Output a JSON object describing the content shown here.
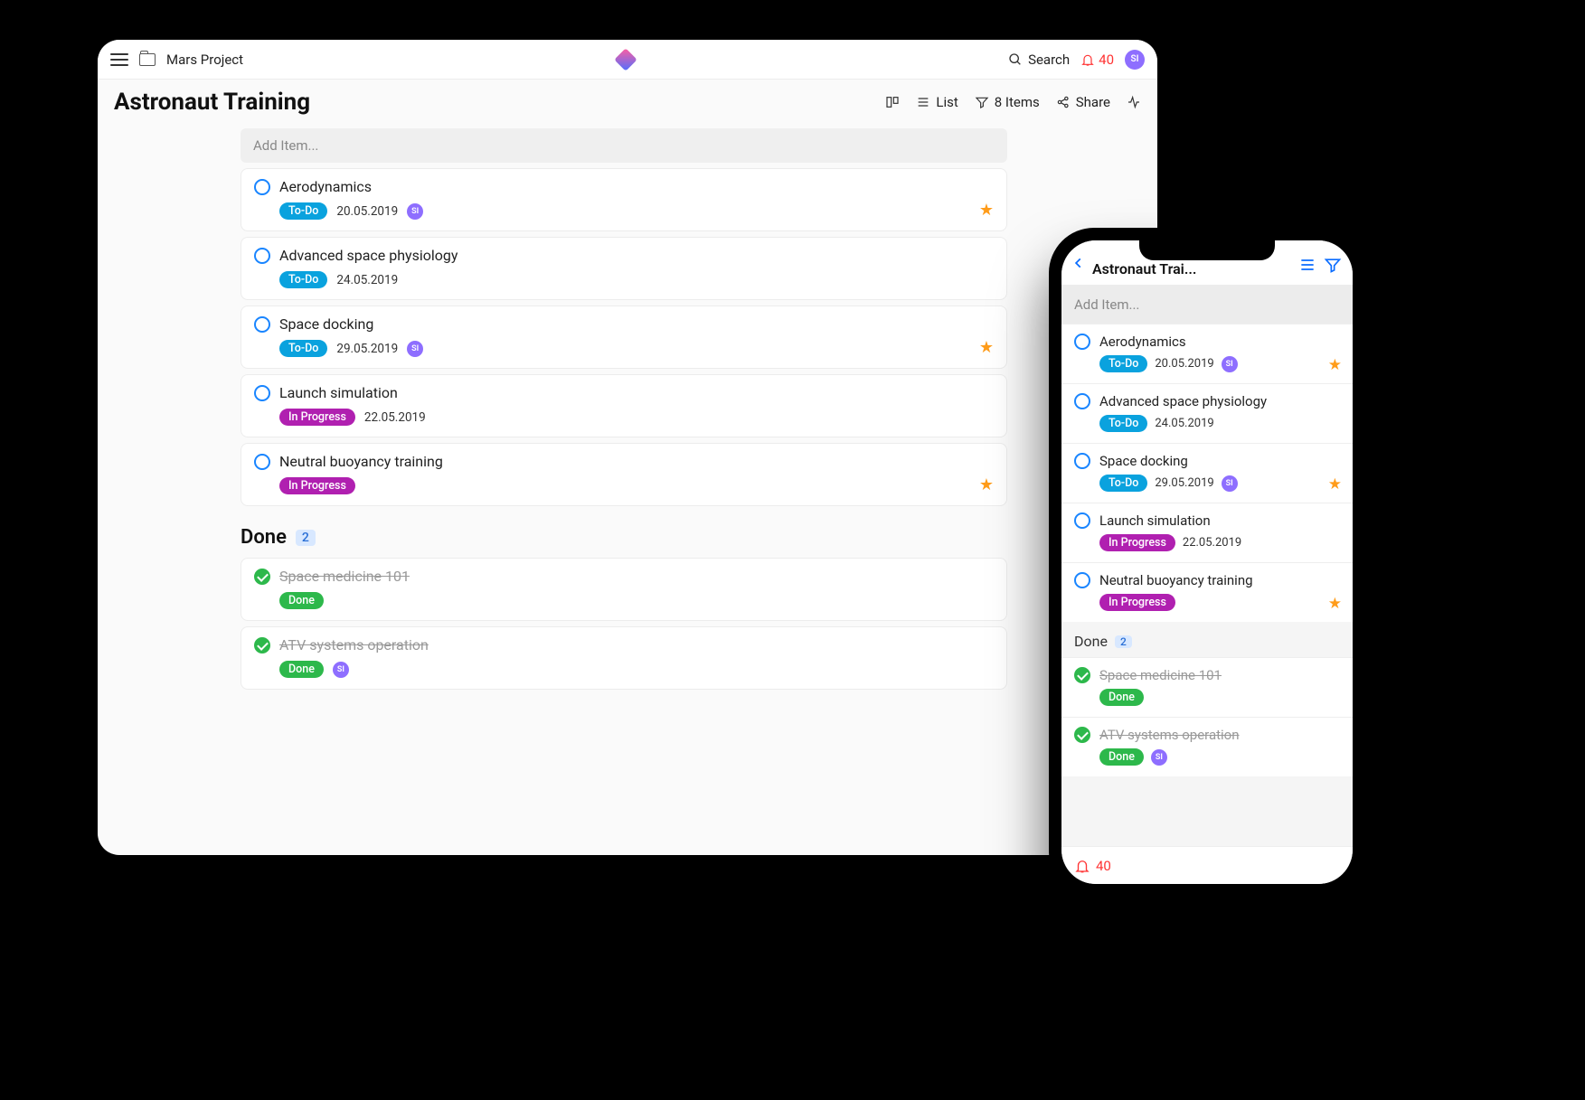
{
  "colors": {
    "accent_blue": "#1985ff",
    "status_todo": "#0aa2de",
    "status_inprogress": "#b020b0",
    "status_done": "#2db84b",
    "star": "#ff9c1a",
    "notification": "#ff3333",
    "avatar": "#8e6eff"
  },
  "topbar": {
    "project_name": "Mars Project",
    "search_label": "Search",
    "notification_count": "40",
    "avatar_initials": "SI"
  },
  "page": {
    "title": "Astronaut Training",
    "tools": {
      "list_label": "List",
      "items_label": "8 Items",
      "share_label": "Share"
    },
    "add_item_placeholder": "Add Item..."
  },
  "items": [
    {
      "title": "Aerodynamics",
      "status": "To-Do",
      "status_class": "todo",
      "date": "20.05.2019",
      "assignee": "SI",
      "starred": true,
      "done": false
    },
    {
      "title": "Advanced space physiology",
      "status": "To-Do",
      "status_class": "todo",
      "date": "24.05.2019",
      "assignee": null,
      "starred": false,
      "done": false
    },
    {
      "title": "Space docking",
      "status": "To-Do",
      "status_class": "todo",
      "date": "29.05.2019",
      "assignee": "SI",
      "starred": true,
      "done": false
    },
    {
      "title": "Launch simulation",
      "status": "In Progress",
      "status_class": "inprog",
      "date": "22.05.2019",
      "assignee": null,
      "starred": false,
      "done": false
    },
    {
      "title": "Neutral buoyancy training",
      "status": "In Progress",
      "status_class": "inprog",
      "date": null,
      "assignee": null,
      "starred": true,
      "done": false
    }
  ],
  "done_group": {
    "label": "Done",
    "count": "2",
    "items": [
      {
        "title": "Space medicine 101",
        "status": "Done",
        "status_class": "done",
        "assignee": null,
        "done": true
      },
      {
        "title": "ATV systems operation",
        "status": "Done",
        "status_class": "done",
        "assignee": "SI",
        "done": true
      }
    ]
  },
  "phone": {
    "title": "Astronaut Trai...",
    "add_item_placeholder": "Add Item...",
    "notification_count": "40"
  }
}
